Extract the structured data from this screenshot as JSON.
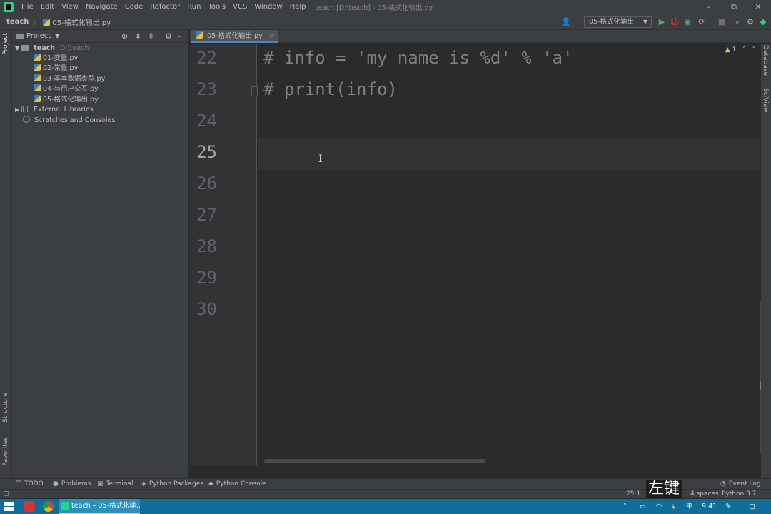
{
  "menubar": {
    "items": [
      "File",
      "Edit",
      "View",
      "Navigate",
      "Code",
      "Refactor",
      "Run",
      "Tools",
      "VCS",
      "Window",
      "Help"
    ],
    "window_title": "teach [D:\\teach] - 05-格式化输出.py",
    "restore_glyph": "⧉",
    "close_glyph": "✕"
  },
  "navbar": {
    "root": "teach",
    "file": "05-格式化输出.py",
    "run_config": "05-格式化输出"
  },
  "project": {
    "title": "Project",
    "root_name": "teach",
    "root_path": "D:\\teach",
    "files": [
      "01-变量.py",
      "02-常量.py",
      "03-基本数据类型.py",
      "04-与用户交互.py",
      "05-格式化输出.py"
    ],
    "external_libraries": "External Libraries",
    "scratches": "Scratches and Consoles"
  },
  "left_stripe": {
    "project": "Project",
    "structure": "Structure",
    "favorites": "Favorites"
  },
  "right_stripe": {
    "database": "Database",
    "sciview": "SciView"
  },
  "editor": {
    "tab": "05-格式化输出.py",
    "line_numbers": [
      "22",
      "23",
      "24",
      "25",
      "26",
      "27",
      "28",
      "29",
      "30"
    ],
    "current_line": "25",
    "lines": [
      "# info = 'my name is %d' % 'a'",
      "# print(info)",
      "",
      "",
      "",
      "",
      "",
      "",
      ""
    ],
    "warning_count": "1"
  },
  "bottom_tools": {
    "todo": "TODO",
    "problems": "Problems",
    "terminal": "Terminal",
    "python_packages": "Python Packages",
    "python_console": "Python Console",
    "event_log": "Event Log"
  },
  "status": {
    "position": "25:1",
    "indent": "4 spaces",
    "interpreter": "Python 3.7",
    "overlay": "左键"
  },
  "taskbar": {
    "app_label": "teach – 05-格式化输...",
    "ime": "中",
    "time": "9:41"
  },
  "colors": {
    "accent": "#4a88c7",
    "run_green": "#59a869",
    "taskbar": "#0f6e99"
  }
}
